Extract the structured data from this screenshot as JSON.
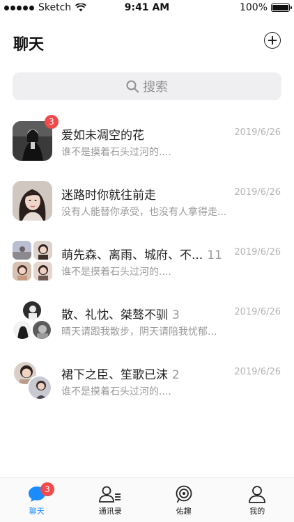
{
  "status_bar": {
    "carrier": "Sketch",
    "time": "9:41 AM",
    "battery": "100%"
  },
  "header": {
    "title": "聊天"
  },
  "search": {
    "placeholder": "搜索"
  },
  "chats": [
    {
      "name": "爱如未凋空的花",
      "count": "",
      "preview": "谁不是摸着石头过河的....",
      "date": "2019/6/26",
      "unread": "3"
    },
    {
      "name": "迷路时你就往前走",
      "count": "",
      "preview": "没有人能替你承受，也没有人拿得走...",
      "date": "2019/6/26",
      "unread": ""
    },
    {
      "name": "萌先森、离雨、城府、不...",
      "count": "11",
      "preview": "谁不是摸着石头过河的....",
      "date": "2019/6/26",
      "unread": ""
    },
    {
      "name": "散、礼忱、桀骜不驯",
      "count": "3",
      "preview": "晴天请跟我散步，阴天请陪我忧郁...",
      "date": "2019/6/26",
      "unread": ""
    },
    {
      "name": "裙下之臣、笙歌已沫",
      "count": "2",
      "preview": "谁不是摸着石头过河的....",
      "date": "2019/6/26",
      "unread": ""
    }
  ],
  "tab_bar": {
    "tabs": [
      {
        "label": "聊天",
        "icon": "chat-bubble-icon",
        "active": true,
        "badge": "3"
      },
      {
        "label": "通讯录",
        "icon": "contacts-icon",
        "active": false
      },
      {
        "label": "佑趣",
        "icon": "discover-icon",
        "active": false
      },
      {
        "label": "我的",
        "icon": "profile-icon",
        "active": false
      }
    ]
  },
  "colors": {
    "accent": "#1a8cff",
    "badge": "#f04a4a",
    "search_bg": "#efeff1",
    "muted_text": "#9a9a9a"
  }
}
